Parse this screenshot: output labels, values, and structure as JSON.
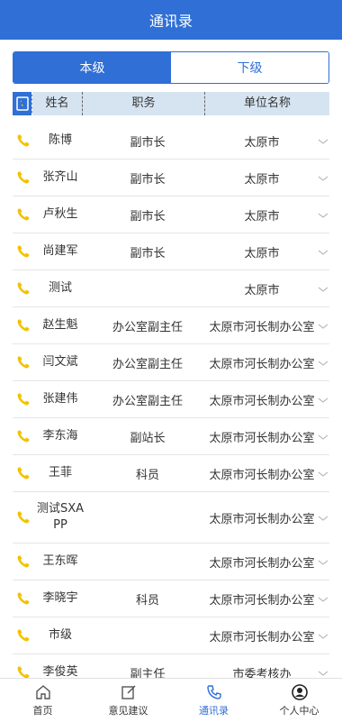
{
  "header": {
    "title": "通讯录"
  },
  "segment": {
    "tabs": [
      "本级",
      "下级"
    ]
  },
  "table": {
    "headers": [
      "姓名",
      "职务",
      "单位名称"
    ],
    "rows": [
      {
        "name": "陈博",
        "position": "副市长",
        "unit": "太原市"
      },
      {
        "name": "张齐山",
        "position": "副市长",
        "unit": "太原市"
      },
      {
        "name": "卢秋生",
        "position": "副市长",
        "unit": "太原市"
      },
      {
        "name": "尚建军",
        "position": "副市长",
        "unit": "太原市"
      },
      {
        "name": "测试",
        "position": "",
        "unit": "太原市"
      },
      {
        "name": "赵生魁",
        "position": "办公室副主任",
        "unit": "太原市河长制办公室"
      },
      {
        "name": "闫文斌",
        "position": "办公室副主任",
        "unit": "太原市河长制办公室"
      },
      {
        "name": "张建伟",
        "position": "办公室副主任",
        "unit": "太原市河长制办公室"
      },
      {
        "name": "李东海",
        "position": "副站长",
        "unit": "太原市河长制办公室"
      },
      {
        "name": "王菲",
        "position": "科员",
        "unit": "太原市河长制办公室"
      },
      {
        "name": "测试SXAPP",
        "position": "",
        "unit": "太原市河长制办公室"
      },
      {
        "name": "王东晖",
        "position": "",
        "unit": "太原市河长制办公室"
      },
      {
        "name": "李晓宇",
        "position": "科员",
        "unit": "太原市河长制办公室"
      },
      {
        "name": "市级",
        "position": "",
        "unit": "太原市河长制办公室"
      },
      {
        "name": "李俊英",
        "position": "副主任",
        "unit": "市委考核办"
      }
    ]
  },
  "tabbar": {
    "items": [
      {
        "label": "首页",
        "icon": "home-icon"
      },
      {
        "label": "意见建议",
        "icon": "edit-icon"
      },
      {
        "label": "通讯录",
        "icon": "phone-icon"
      },
      {
        "label": "个人中心",
        "icon": "user-icon"
      }
    ],
    "active": "通讯录"
  },
  "colors": {
    "primary": "#2f6fd6",
    "phone": "#f2c200",
    "header_bg": "#d6e4f2"
  }
}
